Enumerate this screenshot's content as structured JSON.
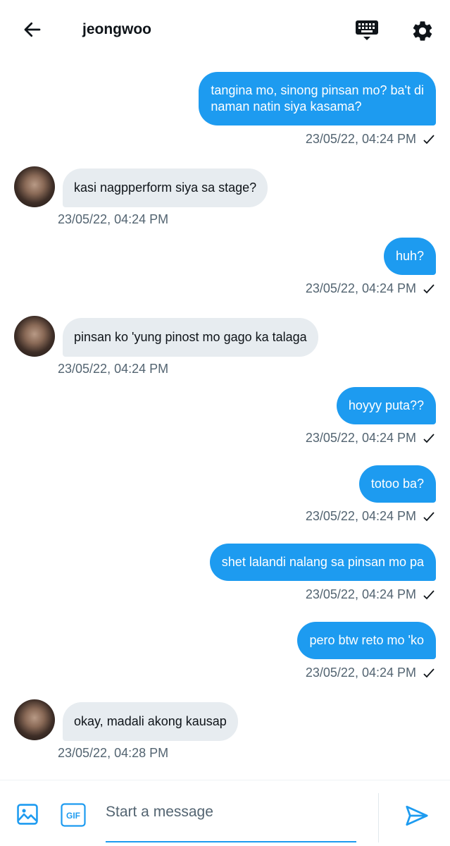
{
  "header": {
    "title": "jeongwoo",
    "icons": {
      "back": "arrow-left-icon",
      "keyboard": "keyboard-icon",
      "settings": "gear-icon"
    }
  },
  "messages": [
    {
      "dir": "out",
      "lines": [
        "tangina mo, sinong pinsan mo? ba't di",
        "naman natin siya kasama?"
      ],
      "time": "23/05/22, 04:24 PM"
    },
    {
      "dir": "in",
      "lines": [
        "kasi nagpperform siya sa stage?"
      ],
      "time": "23/05/22, 04:24 PM"
    },
    {
      "dir": "out",
      "lines": [
        "huh?"
      ],
      "time": "23/05/22, 04:24 PM"
    },
    {
      "dir": "in",
      "lines": [
        "pinsan ko 'yung pinost mo gago ka talaga"
      ],
      "time": "23/05/22, 04:24 PM"
    },
    {
      "dir": "out",
      "lines": [
        "hoyyy puta??"
      ],
      "time": "23/05/22, 04:24 PM"
    },
    {
      "dir": "out",
      "lines": [
        "totoo ba?"
      ],
      "time": "23/05/22, 04:24 PM"
    },
    {
      "dir": "out",
      "lines": [
        "shet lalandi nalang sa pinsan mo pa"
      ],
      "time": "23/05/22, 04:24 PM"
    },
    {
      "dir": "out",
      "lines": [
        "pero btw reto mo 'ko"
      ],
      "time": "23/05/22, 04:24 PM"
    },
    {
      "dir": "in",
      "lines": [
        "okay, madali akong kausap"
      ],
      "time": "23/05/22, 04:28 PM"
    }
  ],
  "composer": {
    "placeholder": "Start a message",
    "gif_label": "GIF",
    "icons": {
      "image": "image-icon",
      "gif": "gif-icon",
      "send": "send-icon"
    }
  },
  "colors": {
    "accent": "#1d9bf0",
    "incoming_bubble": "#e7ecf0",
    "muted_text": "#536471"
  }
}
